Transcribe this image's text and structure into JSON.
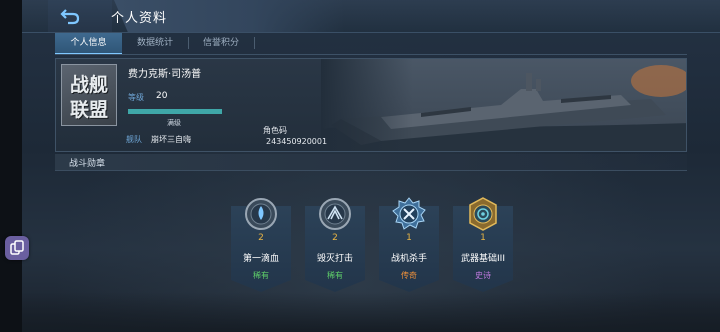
{
  "header": {
    "title": "个人资料"
  },
  "tabs": [
    {
      "label": "个人信息",
      "active": true
    },
    {
      "label": "数据统计",
      "active": false
    },
    {
      "label": "信誉积分",
      "active": false
    }
  ],
  "profile": {
    "logo_line1": "战舰",
    "logo_line2": "联盟",
    "name": "费力克斯·司汤普",
    "level_label": "等级",
    "level_value": "20",
    "level_progress": 1.0,
    "max_text": "满级",
    "fleet_label": "舰队",
    "fleet_value": "崩坏三自嗨",
    "role_code_label": "角色码",
    "role_code_value": "243450920001"
  },
  "section": {
    "title": "战斗勋章"
  },
  "medals": [
    {
      "count": "2",
      "name": "第一滴血",
      "rarity": "稀有",
      "rarity_color": "#5fd06a",
      "icon": "drop-medal-icon"
    },
    {
      "count": "2",
      "name": "毁灭打击",
      "rarity": "稀有",
      "rarity_color": "#5fd06a",
      "icon": "strike-medal-icon"
    },
    {
      "count": "1",
      "name": "战机杀手",
      "rarity": "传奇",
      "rarity_color": "#f2923a",
      "icon": "fighter-medal-icon"
    },
    {
      "count": "1",
      "name": "武器基础III",
      "rarity": "史诗",
      "rarity_color": "#c07ae0",
      "icon": "weapon-medal-icon"
    }
  ],
  "colors": {
    "accent": "#7fc7ff",
    "level_bar": "#3fa7a8",
    "count": "#e8b444"
  }
}
